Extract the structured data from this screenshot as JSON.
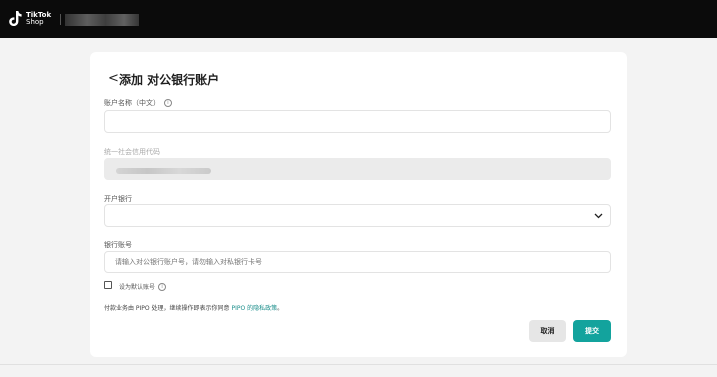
{
  "header": {
    "brand_line1": "TikTok",
    "brand_line2": "Shop"
  },
  "page": {
    "back_glyph": "<",
    "title": "添加 对公银行账户"
  },
  "form": {
    "account_name": {
      "label": "账户名称（中文）",
      "value": "",
      "placeholder": ""
    },
    "credit_code": {
      "label": "统一社会信用代码"
    },
    "bank": {
      "label": "开户银行",
      "value": ""
    },
    "account_number": {
      "label": "银行账号",
      "placeholder": "请输入对公银行账户号，请勿输入对私银行卡号"
    },
    "default_checkbox": {
      "label": "设为默认账号",
      "checked": false
    },
    "notice": {
      "prefix": "付款业务由 PIPO 处理，继续操作即表示你同意 ",
      "link": "PIPO 的隐私政策",
      "suffix": "。"
    }
  },
  "buttons": {
    "cancel": "取消",
    "submit": "提交"
  },
  "colors": {
    "accent": "#13a39d",
    "topbar": "#0b0b0b"
  }
}
